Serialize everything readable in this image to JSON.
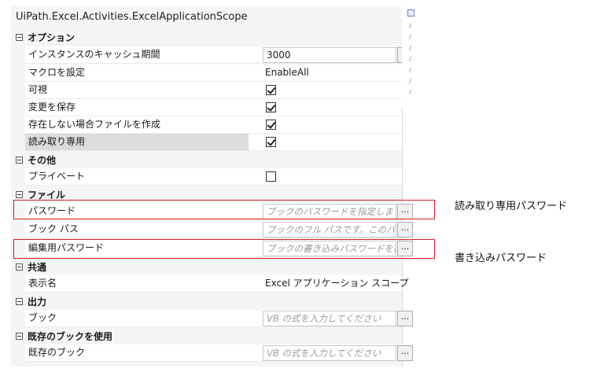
{
  "window": {
    "title": "UiPath.Excel.Activities.ExcelApplicationScope"
  },
  "categories": {
    "options": "オプション",
    "other": "その他",
    "file": "ファイル",
    "common": "共通",
    "output": "出力",
    "use_existing": "既存のブックを使用"
  },
  "properties": {
    "cache_period": {
      "label": "インスタンスのキャッシュ期間",
      "value": "3000",
      "button": "..."
    },
    "macro": {
      "label": "マクロを設定",
      "value": "EnableAll"
    },
    "visible": {
      "label": "可視",
      "checked": true
    },
    "save_changes": {
      "label": "変更を保存",
      "checked": true
    },
    "create_if_missing": {
      "label": "存在しない場合ファイルを作成",
      "checked": true
    },
    "read_only": {
      "label": "読み取り専用",
      "checked": true
    },
    "private": {
      "label": "プライベート",
      "checked": false
    },
    "password": {
      "label": "パスワード",
      "placeholder": "ブックのパスワードを指定します (必",
      "button": "..."
    },
    "book_path": {
      "label": "ブック パス",
      "placeholder": "ブックのフル パスです。このパスにフ",
      "button": "..."
    },
    "edit_password": {
      "label": "編集用パスワード",
      "placeholder": "ブックの書き込みパスワードを指定しま",
      "button": "..."
    },
    "display_name": {
      "label": "表示名",
      "value": "Excel アプリケーション スコープ"
    },
    "workbook": {
      "label": "ブック",
      "placeholder": "VB の式を入力してください",
      "button": "..."
    },
    "existing_workbook": {
      "label": "既存のブック",
      "placeholder": "VB の式を入力してください",
      "button": "..."
    }
  },
  "annotations": {
    "read_only_password": "読み取り専用パスワード",
    "write_password": "書き込みパスワード"
  }
}
